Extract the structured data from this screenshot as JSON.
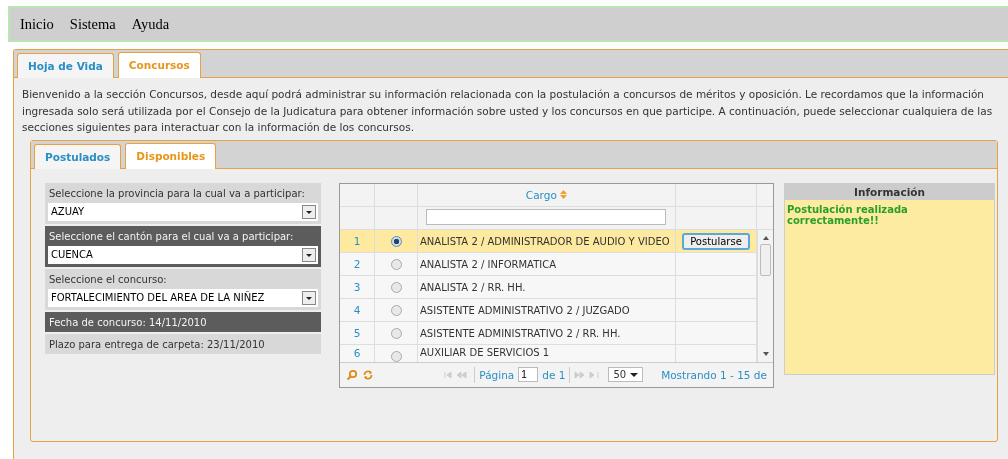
{
  "menu": [
    "Inicio",
    "Sistema",
    "Ayuda"
  ],
  "tabs": [
    {
      "label": "Hoja de Vida",
      "selected": false
    },
    {
      "label": "Concursos",
      "selected": true
    }
  ],
  "intro": "Bienvenido a la sección Concursos, desde aquí podrá administrar su información relacionada con la postulación a concursos de méritos y oposición. Le recordamos que la información ingresada solo será utilizada por el Consejo de la Judicatura para obtener información sobre usted y los concursos en que participe. A continuación, puede seleccionar cualquiera de las secciones siguientes para interactuar con la información de los concursos.",
  "subtabs": [
    {
      "label": "Postulados",
      "selected": false
    },
    {
      "label": "Disponibles",
      "selected": true
    }
  ],
  "filters": [
    {
      "kind": "select",
      "label": "Seleccione la provincia para la cual va a participar:",
      "value": "AZUAY",
      "highlighted": false
    },
    {
      "kind": "select",
      "label": "Seleccione el cantón para el cual va a participar:",
      "value": "CUENCA",
      "highlighted": true
    },
    {
      "kind": "select",
      "label": "Seleccione el concurso:",
      "value": "FORTALECIMIENTO DEL AREA DE LA NIÑEZ",
      "highlighted": false
    },
    {
      "kind": "text",
      "label": "Fecha de concurso: 14/11/2010",
      "highlighted": true
    },
    {
      "kind": "text",
      "label": "Plazo para entrega de carpeta: 23/11/2010",
      "highlighted": false
    }
  ],
  "grid": {
    "column": "Cargo",
    "rows": [
      {
        "num": "1",
        "cargo": "ANALISTA 2 / ADMINISTRADOR DE AUDIO Y VIDEO",
        "selected": true,
        "action": "Postularse"
      },
      {
        "num": "2",
        "cargo": "ANALISTA 2 / INFORMATICA",
        "selected": false
      },
      {
        "num": "3",
        "cargo": "ANALISTA 2 / RR. HH.",
        "selected": false
      },
      {
        "num": "4",
        "cargo": "ASISTENTE ADMINISTRATIVO 2 / JUZGADO",
        "selected": false
      },
      {
        "num": "5",
        "cargo": "ASISTENTE ADMINISTRATIVO 2 / RR. HH.",
        "selected": false
      },
      {
        "num": "6",
        "cargo": "AUXILIAR DE SERVICIOS 1",
        "selected": false
      }
    ],
    "pager": {
      "page_label": "Página",
      "page": "1",
      "of": "de 1",
      "page_size": "50",
      "summary": "Mostrando 1 - 15 de"
    }
  },
  "info": {
    "title": "Información",
    "message": "Postulación realizada correctamente!!"
  }
}
